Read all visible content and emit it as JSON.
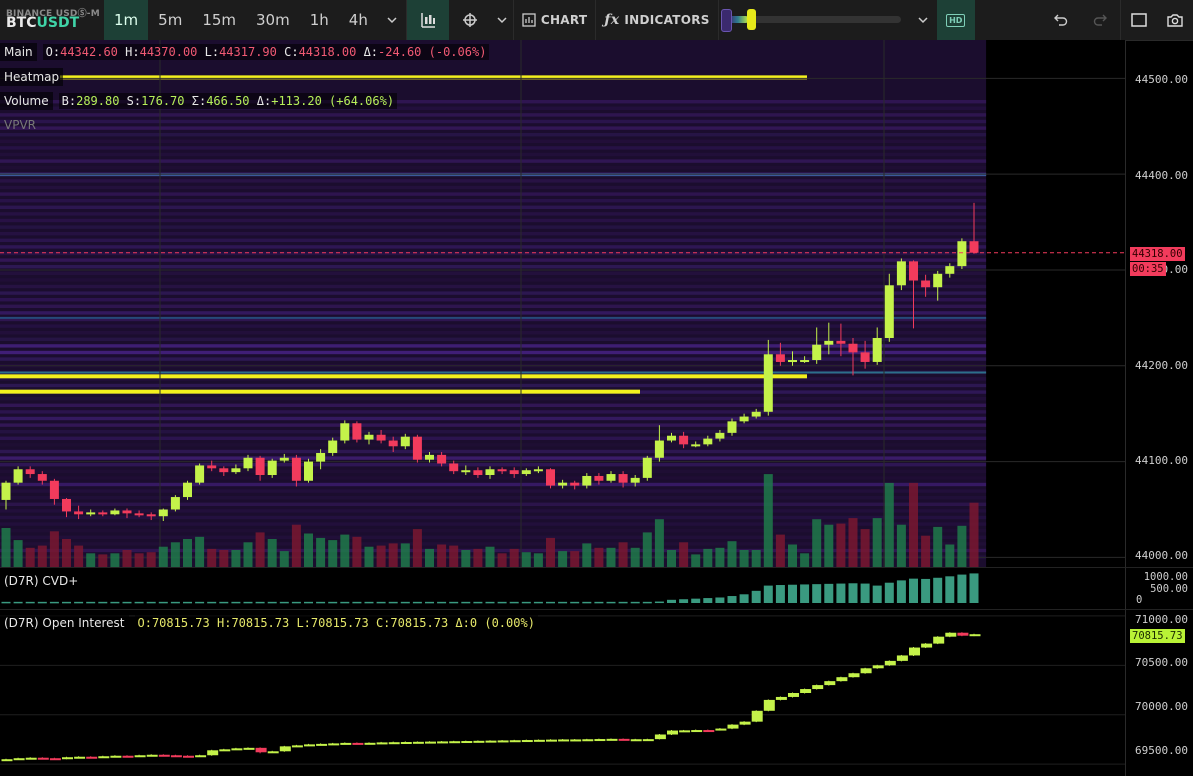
{
  "toolbar": {
    "exchange": "BINANCE USDⓈ-M",
    "pair_base": "BTC",
    "pair_quote": "USDT",
    "timeframes": [
      "1m",
      "5m",
      "15m",
      "30m",
      "1h",
      "4h"
    ],
    "active_timeframe": "1m",
    "chart_label": "CHART",
    "indicators_label": "INDICATORS",
    "hd_label": "HD",
    "icons": [
      "chevron-down-icon",
      "candles-icon",
      "crosshair-icon",
      "chart-type-icon",
      "fx-icon",
      "undo-icon",
      "redo-icon",
      "fullscreen-icon",
      "camera-icon"
    ]
  },
  "legend": {
    "main": {
      "name": "Main",
      "o": "44342.60",
      "h": "44370.00",
      "l": "44317.90",
      "c": "44318.00",
      "delta": "-24.60 (-0.06%)"
    },
    "heatmap": {
      "name": "Heatmap"
    },
    "volume": {
      "name": "Volume",
      "b": "289.80",
      "s": "176.70",
      "sigma": "466.50",
      "delta": "+113.20 (+64.06%)"
    },
    "vpvr": {
      "name": "VPVR"
    },
    "cvd": {
      "name": "(D7R) CVD+"
    },
    "oi": {
      "name": "(D7R) Open Interest",
      "o": "70815.73",
      "h": "70815.73",
      "l": "70815.73",
      "c": "70815.73",
      "delta": "0 (0.00%)"
    }
  },
  "axis": {
    "main_labels": [
      "44500.00",
      "44400.00",
      "44300.00",
      "44200.00",
      "44100.00",
      "44000.00"
    ],
    "current_price": "44318.00",
    "countdown": "00:35",
    "cvd_labels": [
      "1000.00",
      "500.00",
      "0"
    ],
    "oi_labels": [
      "71000.00",
      "70500.00",
      "70000.00",
      "69500.00"
    ],
    "oi_current": "70815.73"
  },
  "colors": {
    "up": "#c4f24a",
    "down": "#f23b5c",
    "accent": "#1d4036",
    "volume_up": "#1f7a4a",
    "volume_down": "#7a1830",
    "cvd": "#3a9a80"
  },
  "chart_data": [
    {
      "type": "candlestick",
      "title": "BTCUSDT 1m",
      "ylim": [
        43990,
        44540
      ],
      "candles": [
        [
          44060,
          44078,
          44050,
          44080
        ],
        [
          44078,
          44092,
          44076,
          44095
        ],
        [
          44092,
          44087,
          44083,
          44095
        ],
        [
          44087,
          44080,
          44076,
          44090
        ],
        [
          44080,
          44061,
          44055,
          44082
        ],
        [
          44061,
          44048,
          44042,
          44062
        ],
        [
          44048,
          44045,
          44040,
          44054
        ],
        [
          44045,
          44047,
          44043,
          44050
        ],
        [
          44047,
          44045,
          44043,
          44049
        ],
        [
          44045,
          44049,
          44044,
          44051
        ],
        [
          44049,
          44046,
          44041,
          44051
        ],
        [
          44046,
          44045,
          44042,
          44049
        ],
        [
          44045,
          44043,
          44039,
          44047
        ],
        [
          44043,
          44050,
          44038,
          44051
        ],
        [
          44050,
          44063,
          44048,
          44065
        ],
        [
          44063,
          44078,
          44060,
          44080
        ],
        [
          44078,
          44096,
          44076,
          44098
        ],
        [
          44096,
          44093,
          44090,
          44101
        ],
        [
          44093,
          44089,
          44085,
          44095
        ],
        [
          44089,
          44093,
          44087,
          44097
        ],
        [
          44093,
          44104,
          44090,
          44107
        ],
        [
          44104,
          44086,
          44080,
          44106
        ],
        [
          44086,
          44101,
          44083,
          44103
        ],
        [
          44101,
          44104,
          44099,
          44108
        ],
        [
          44104,
          44080,
          44074,
          44107
        ],
        [
          44080,
          44100,
          44078,
          44103
        ],
        [
          44100,
          44109,
          44092,
          44113
        ],
        [
          44109,
          44122,
          44106,
          44125
        ],
        [
          44122,
          44140,
          44119,
          44143
        ],
        [
          44140,
          44123,
          44120,
          44142
        ],
        [
          44123,
          44128,
          44118,
          44131
        ],
        [
          44128,
          44122,
          44119,
          44133
        ],
        [
          44122,
          44116,
          44110,
          44126
        ],
        [
          44116,
          44126,
          44113,
          44129
        ],
        [
          44126,
          44102,
          44099,
          44128
        ],
        [
          44102,
          44107,
          44099,
          44110
        ],
        [
          44107,
          44098,
          44095,
          44110
        ],
        [
          44098,
          44090,
          44087,
          44101
        ],
        [
          44090,
          44091,
          44086,
          44096
        ],
        [
          44091,
          44086,
          44083,
          44094
        ],
        [
          44086,
          44092,
          44082,
          44095
        ],
        [
          44092,
          44091,
          44087,
          44094
        ],
        [
          44091,
          44087,
          44083,
          44094
        ],
        [
          44087,
          44091,
          44085,
          44093
        ],
        [
          44091,
          44092,
          44088,
          44095
        ],
        [
          44092,
          44075,
          44072,
          44093
        ],
        [
          44075,
          44078,
          44072,
          44081
        ],
        [
          44078,
          44075,
          44071,
          44080
        ],
        [
          44075,
          44085,
          44072,
          44088
        ],
        [
          44085,
          44080,
          44076,
          44088
        ],
        [
          44080,
          44087,
          44078,
          44090
        ],
        [
          44087,
          44078,
          44073,
          44090
        ],
        [
          44078,
          44083,
          44074,
          44086
        ],
        [
          44083,
          44104,
          44080,
          44106
        ],
        [
          44104,
          44122,
          44100,
          44138
        ],
        [
          44122,
          44127,
          44120,
          44130
        ],
        [
          44127,
          44118,
          44114,
          44131
        ],
        [
          44118,
          44118,
          44115,
          44121
        ],
        [
          44118,
          44124,
          44116,
          44127
        ],
        [
          44124,
          44130,
          44121,
          44133
        ],
        [
          44130,
          44142,
          44127,
          44145
        ],
        [
          44142,
          44147,
          44140,
          44150
        ],
        [
          44147,
          44152,
          44145,
          44155
        ],
        [
          44152,
          44212,
          44148,
          44227
        ],
        [
          44212,
          44204,
          44200,
          44224
        ],
        [
          44204,
          44206,
          44200,
          44215
        ],
        [
          44206,
          44206,
          44203,
          44210
        ],
        [
          44206,
          44222,
          44202,
          44240
        ],
        [
          44222,
          44226,
          44212,
          44245
        ],
        [
          44226,
          44223,
          44210,
          44244
        ],
        [
          44223,
          44214,
          44190,
          44229
        ],
        [
          44214,
          44204,
          44197,
          44226
        ],
        [
          44204,
          44229,
          44201,
          44240
        ],
        [
          44229,
          44284,
          44225,
          44296
        ],
        [
          44284,
          44309,
          44279,
          44312
        ],
        [
          44309,
          44289,
          44239,
          44310
        ],
        [
          44289,
          44282,
          44272,
          44295
        ],
        [
          44282,
          44296,
          44268,
          44299
        ],
        [
          44296,
          44304,
          44292,
          44307
        ],
        [
          44304,
          44330,
          44301,
          44333
        ],
        [
          44330,
          44318,
          44317,
          44370
        ]
      ]
    },
    {
      "type": "bar",
      "title": "CVD+",
      "ylim": [
        0,
        1000
      ],
      "values": [
        40,
        40,
        40,
        40,
        40,
        40,
        40,
        40,
        40,
        40,
        40,
        40,
        40,
        40,
        40,
        40,
        40,
        40,
        40,
        40,
        40,
        40,
        40,
        40,
        40,
        40,
        40,
        40,
        40,
        40,
        40,
        40,
        40,
        40,
        40,
        40,
        40,
        40,
        40,
        40,
        40,
        40,
        40,
        40,
        40,
        40,
        40,
        40,
        40,
        40,
        40,
        40,
        40,
        40,
        50,
        110,
        130,
        150,
        170,
        190,
        240,
        300,
        420,
        600,
        620,
        630,
        640,
        650,
        660,
        670,
        680,
        670,
        600,
        700,
        780,
        840,
        830,
        870,
        920,
        980,
        1020
      ]
    },
    {
      "type": "candlestick",
      "title": "Open Interest",
      "ylim": [
        69380,
        71060
      ],
      "candles": [
        [
          69540,
          69550,
          69535,
          69555
        ],
        [
          69550,
          69560,
          69545,
          69565
        ],
        [
          69560,
          69565,
          69555,
          69570
        ],
        [
          69565,
          69560,
          69555,
          69570
        ],
        [
          69560,
          69555,
          69550,
          69565
        ],
        [
          69555,
          69570,
          69550,
          69575
        ],
        [
          69570,
          69575,
          69565,
          69580
        ],
        [
          69575,
          69570,
          69565,
          69580
        ],
        [
          69570,
          69580,
          69565,
          69585
        ],
        [
          69580,
          69585,
          69575,
          69590
        ],
        [
          69585,
          69580,
          69575,
          69590
        ],
        [
          69580,
          69590,
          69575,
          69595
        ],
        [
          69590,
          69595,
          69585,
          69600
        ],
        [
          69595,
          69590,
          69585,
          69600
        ],
        [
          69590,
          69585,
          69580,
          69595
        ],
        [
          69585,
          69580,
          69575,
          69590
        ],
        [
          69580,
          69590,
          69575,
          69595
        ],
        [
          69590,
          69640,
          69585,
          69645
        ],
        [
          69640,
          69650,
          69635,
          69655
        ],
        [
          69650,
          69660,
          69645,
          69665
        ],
        [
          69660,
          69665,
          69655,
          69670
        ],
        [
          69665,
          69620,
          69610,
          69670
        ],
        [
          69620,
          69630,
          69615,
          69635
        ],
        [
          69630,
          69680,
          69625,
          69685
        ],
        [
          69680,
          69690,
          69675,
          69695
        ],
        [
          69690,
          69700,
          69685,
          69705
        ],
        [
          69700,
          69705,
          69695,
          69710
        ],
        [
          69705,
          69710,
          69700,
          69715
        ],
        [
          69710,
          69715,
          69705,
          69720
        ],
        [
          69715,
          69712,
          69705,
          69720
        ],
        [
          69712,
          69716,
          69708,
          69720
        ],
        [
          69716,
          69720,
          69712,
          69725
        ],
        [
          69720,
          69722,
          69715,
          69728
        ],
        [
          69722,
          69724,
          69718,
          69730
        ],
        [
          69724,
          69726,
          69720,
          69730
        ],
        [
          69726,
          69728,
          69722,
          69732
        ],
        [
          69728,
          69730,
          69724,
          69734
        ],
        [
          69730,
          69732,
          69726,
          69736
        ],
        [
          69732,
          69734,
          69728,
          69738
        ],
        [
          69734,
          69736,
          69730,
          69740
        ],
        [
          69736,
          69738,
          69732,
          69742
        ],
        [
          69738,
          69740,
          69734,
          69744
        ],
        [
          69740,
          69742,
          69736,
          69746
        ],
        [
          69742,
          69744,
          69738,
          69748
        ],
        [
          69744,
          69746,
          69740,
          69750
        ],
        [
          69746,
          69748,
          69742,
          69752
        ],
        [
          69748,
          69750,
          69744,
          69754
        ],
        [
          69750,
          69750,
          69746,
          69754
        ],
        [
          69750,
          69752,
          69746,
          69756
        ],
        [
          69752,
          69754,
          69748,
          69758
        ],
        [
          69754,
          69756,
          69750,
          69760
        ],
        [
          69756,
          69750,
          69745,
          69760
        ],
        [
          69750,
          69752,
          69746,
          69756
        ],
        [
          69752,
          69753,
          69748,
          69757
        ],
        [
          69753,
          69800,
          69750,
          69805
        ],
        [
          69800,
          69840,
          69795,
          69845
        ],
        [
          69840,
          69842,
          69836,
          69846
        ],
        [
          69842,
          69845,
          69838,
          69850
        ],
        [
          69845,
          69843,
          69838,
          69850
        ],
        [
          69843,
          69860,
          69840,
          69865
        ],
        [
          69860,
          69900,
          69855,
          69905
        ],
        [
          69900,
          69930,
          69895,
          69935
        ],
        [
          69930,
          70040,
          69925,
          70045
        ],
        [
          70040,
          70150,
          70035,
          70155
        ],
        [
          70150,
          70180,
          70145,
          70185
        ],
        [
          70180,
          70220,
          70175,
          70225
        ],
        [
          70220,
          70260,
          70215,
          70265
        ],
        [
          70260,
          70300,
          70255,
          70305
        ],
        [
          70300,
          70340,
          70295,
          70345
        ],
        [
          70340,
          70380,
          70335,
          70385
        ],
        [
          70380,
          70420,
          70375,
          70425
        ],
        [
          70420,
          70470,
          70415,
          70475
        ],
        [
          70470,
          70500,
          70465,
          70505
        ],
        [
          70500,
          70545,
          70495,
          70550
        ],
        [
          70545,
          70600,
          70540,
          70605
        ],
        [
          70600,
          70680,
          70595,
          70685
        ],
        [
          70680,
          70720,
          70675,
          70725
        ],
        [
          70720,
          70790,
          70715,
          70795
        ],
        [
          70790,
          70830,
          70785,
          70835
        ],
        [
          70830,
          70800,
          70795,
          70835
        ],
        [
          70800,
          70815,
          70796,
          70820
        ]
      ]
    }
  ]
}
